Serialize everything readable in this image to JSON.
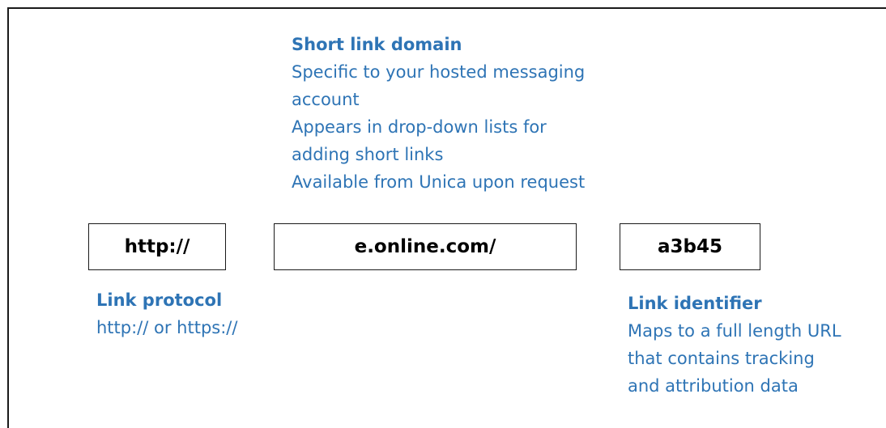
{
  "segments": {
    "protocol": "http://",
    "domain": "e.online.com/",
    "identifier": "a3b45"
  },
  "annotations": {
    "domain": {
      "title": "Short link domain",
      "lines": [
        "Specific to your hosted messaging",
        "account",
        "Appears in drop-down lists for",
        "adding short links",
        "Available from Unica upon request"
      ]
    },
    "protocol": {
      "title": "Link protocol",
      "lines": [
        "http:// or https://"
      ]
    },
    "identifier": {
      "title": "Link identifier",
      "lines": [
        "Maps to a full length URL",
        "that contains tracking",
        "and attribution data"
      ]
    }
  },
  "colors": {
    "annotation_text": "#2e74b5",
    "box_border": "#1a1a1a",
    "box_text": "#000000"
  }
}
